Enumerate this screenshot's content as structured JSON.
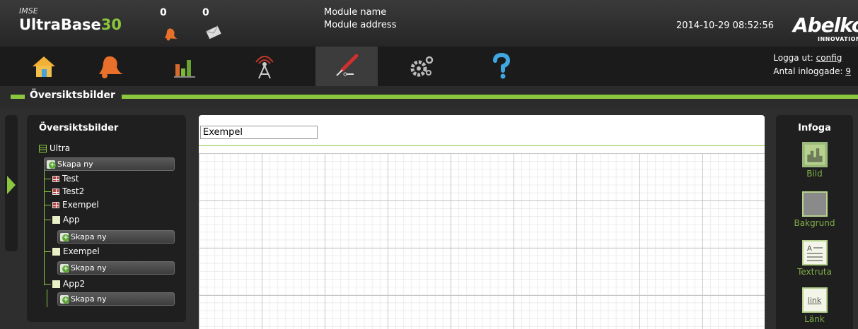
{
  "header": {
    "brand_small": "IMSE",
    "brand_main": "UltraBase",
    "brand_num": "30",
    "alarm_count": "0",
    "message_count": "0",
    "module_name": "Module name",
    "module_address": "Module address",
    "datetime": "2014-10-29 08:52:56",
    "logo": "Abelko",
    "logo_sub": "INNOVATION"
  },
  "nav": {
    "tabs": [
      {
        "icon": "home-icon"
      },
      {
        "icon": "bell-icon"
      },
      {
        "icon": "bar-chart-icon"
      },
      {
        "icon": "antenna-icon"
      },
      {
        "icon": "screwdriver-icon"
      },
      {
        "icon": "gears-icon"
      },
      {
        "icon": "question-icon"
      }
    ],
    "active_tab": 4,
    "logout_label": "Logga ut:",
    "logout_user": "config",
    "logged_in_label": "Antal inloggade:",
    "logged_in_count": "9"
  },
  "section": {
    "title": "Översiktsbilder"
  },
  "tree": {
    "title": "Översiktsbilder",
    "root": "Ultra",
    "create_label": "Skapa ny",
    "pages": [
      "Test",
      "Test2",
      "Exempel"
    ],
    "folders": [
      "App",
      "Exempel",
      "App2"
    ]
  },
  "editor": {
    "name_value": "Exempel"
  },
  "insert": {
    "title": "Infoga",
    "items": [
      {
        "label": "Bild",
        "icon": "image-icon"
      },
      {
        "label": "Bakgrund",
        "icon": "background-icon"
      },
      {
        "label": "Textruta",
        "icon": "textbox-icon"
      },
      {
        "label": "Länk",
        "icon": "link-icon",
        "icon_text": "link"
      }
    ]
  },
  "colors": {
    "accent": "#8bc63f",
    "header_bg": "#2f2f2f",
    "nav_bg": "#1b1b1b"
  }
}
